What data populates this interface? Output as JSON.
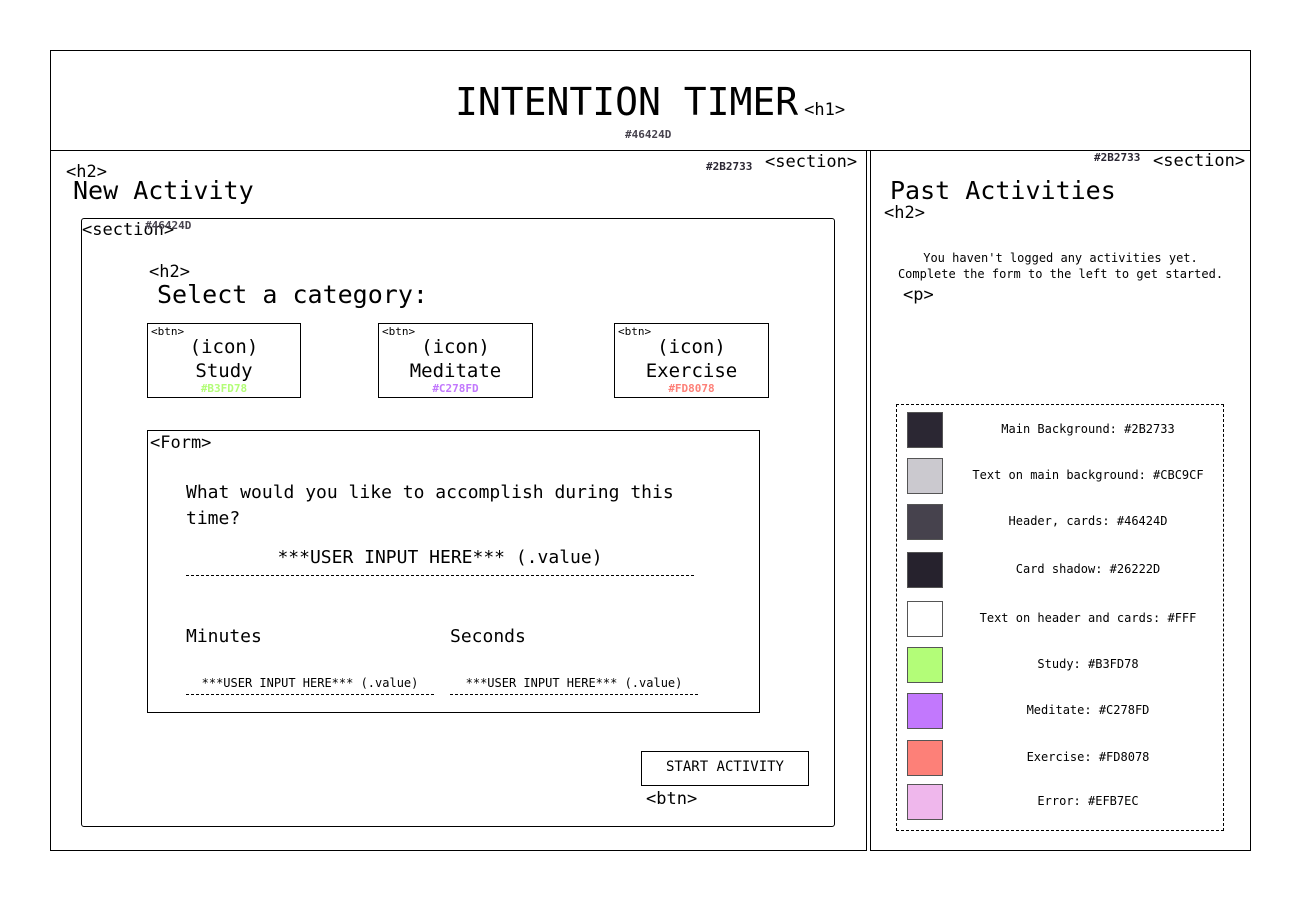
{
  "header": {
    "title": "INTENTION TIMER",
    "tag": "<h1>",
    "hex": "#46424D"
  },
  "new_activity": {
    "h2_tag": "<h2>",
    "title": "New Activity",
    "hex": "#2B2733",
    "section_tag": "<section>",
    "inner": {
      "section_tag": "<section>",
      "hex": "#46424D",
      "h2_tag": "<h2>",
      "title": "Select a category:",
      "categories": [
        {
          "btn_tag": "<btn>",
          "icon": "(icon)",
          "label": "Study",
          "hex": "#B3FD78",
          "color": "#B3FD78"
        },
        {
          "btn_tag": "<btn>",
          "icon": "(icon)",
          "label": "Meditate",
          "hex": "#C278FD",
          "color": "#C278FD"
        },
        {
          "btn_tag": "<btn>",
          "icon": "(icon)",
          "label": "Exercise",
          "hex": "#FD8078",
          "color": "#FD8078"
        }
      ],
      "form": {
        "tag": "<Form>",
        "question": "What would you like to accomplish during this time?",
        "input_value": "***USER INPUT HERE*** (.value)",
        "minutes_label": "Minutes",
        "seconds_label": "Seconds",
        "minutes_value": "***USER INPUT HERE*** (.value)",
        "seconds_value": "***USER INPUT HERE*** (.value)"
      },
      "start_button": {
        "label": "START ACTIVITY",
        "tag": "<btn>"
      }
    }
  },
  "past_activities": {
    "hex": "#2B2733",
    "section_tag": "<section>",
    "title": "Past Activities",
    "h2_tag": "<h2>",
    "empty_line1": "You haven't logged any activities yet.",
    "empty_line2": "Complete the form to the left to get started.",
    "p_tag": "<p>"
  },
  "palette": [
    {
      "label": "Main Background: #2B2733",
      "color": "#2B2733"
    },
    {
      "label": "Text on main background: #CBC9CF",
      "color": "#CBC9CF"
    },
    {
      "label": "Header, cards: #46424D",
      "color": "#46424D"
    },
    {
      "label": "Card shadow: #26222D",
      "color": "#26222D"
    },
    {
      "label": "Text on header and cards: #FFF",
      "color": "#FFFFFF"
    },
    {
      "label": "Study: #B3FD78",
      "color": "#B3FD78"
    },
    {
      "label": "Meditate: #C278FD",
      "color": "#C278FD"
    },
    {
      "label": "Exercise: #FD8078",
      "color": "#FD8078"
    },
    {
      "label": "Error: #EFB7EC",
      "color": "#EFB7EC"
    }
  ]
}
